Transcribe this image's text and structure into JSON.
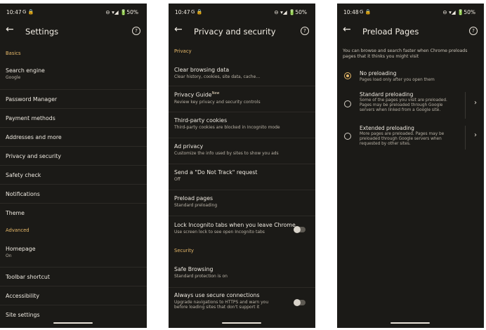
{
  "screen1": {
    "status": {
      "time": "10:47",
      "left_icons": "G 🔒",
      "right": "⊖ ▾◢ 🔋50%"
    },
    "title": "Settings",
    "sections": {
      "basics": "Basics",
      "advanced": "Advanced"
    },
    "items": [
      {
        "title": "Search engine",
        "sub": "Google"
      },
      {
        "title": "Password Manager"
      },
      {
        "title": "Payment methods"
      },
      {
        "title": "Addresses and more"
      },
      {
        "title": "Privacy and security"
      },
      {
        "title": "Safety check"
      },
      {
        "title": "Notifications"
      },
      {
        "title": "Theme"
      },
      {
        "title": "Homepage",
        "sub": "On"
      },
      {
        "title": "Toolbar shortcut"
      },
      {
        "title": "Accessibility"
      },
      {
        "title": "Site settings"
      }
    ]
  },
  "screen2": {
    "status": {
      "time": "10:47",
      "left_icons": "G 🔒",
      "right": "⊖ ▾◢ 🔋50%"
    },
    "title": "Privacy and security",
    "sections": {
      "privacy": "Privacy",
      "security": "Security"
    },
    "items": [
      {
        "title": "Clear browsing data",
        "sub": "Clear history, cookies, site data, cache…"
      },
      {
        "title": "Privacy Guide",
        "badge": "New",
        "sub": "Review key privacy and security controls"
      },
      {
        "title": "Third-party cookies",
        "sub": "Third-party cookies are blocked in Incognito mode"
      },
      {
        "title": "Ad privacy",
        "sub": "Customize the info used by sites to show you ads"
      },
      {
        "title": "Send a \"Do Not Track\" request",
        "sub": "Off"
      },
      {
        "title": "Preload pages",
        "sub": "Standard preloading"
      },
      {
        "title": "Lock Incognito tabs when you leave Chrome",
        "sub": "Use screen lock to see open Incognito tabs"
      },
      {
        "title": "Safe Browsing",
        "sub": "Standard protection is on"
      },
      {
        "title": "Always use secure connections",
        "sub": "Upgrade navigations to HTTPS and warn you",
        "sub2": "before loading sites that don't support it"
      }
    ],
    "toggles": {
      "lock_incognito": false,
      "secure_connections": false
    }
  },
  "screen3": {
    "status": {
      "time": "10:48",
      "left_icons": "G 🔒",
      "right": "⊖ ▾◢ 🔋50%"
    },
    "title": "Preload Pages",
    "description": "You can browse and search faster when Chrome preloads pages that it thinks you might visit",
    "options": [
      {
        "title": "No preloading",
        "desc": "Pages load only after you open them",
        "selected": true
      },
      {
        "title": "Standard preloading",
        "desc": "Some of the pages you visit are preloaded. Pages may be preloaded through Google servers when linked from a Google site.",
        "selected": false
      },
      {
        "title": "Extended preloading",
        "desc": "More pages are preloaded. Pages may be preloaded through Google servers when requested by other sites.",
        "selected": false
      }
    ]
  },
  "colors": {
    "background": "#1b1a17",
    "accent": "#e7b96a",
    "text": "#f0ebe2",
    "subtext": "#b9b2a6"
  },
  "icons": {
    "back": "arrow-left-icon",
    "help": "help-circle-icon",
    "chevron": "chevron-right-icon"
  }
}
